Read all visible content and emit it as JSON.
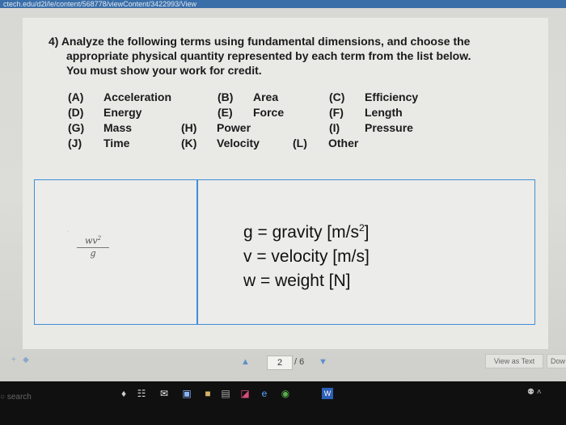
{
  "browser": {
    "url": "ctech.edu/d2l/le/content/568778/viewContent/3422993/View"
  },
  "question": {
    "lines": [
      "4) Analyze the following terms using fundamental dimensions, and choose the",
      "appropriate physical quantity represented by each term from the list below.",
      "You must show your work for credit."
    ],
    "options": [
      {
        "code": "(A)",
        "label": "Acceleration"
      },
      {
        "code": "(B)",
        "label": "Area"
      },
      {
        "code": "(C)",
        "label": "Efficiency"
      },
      {
        "code": "(D)",
        "label": "Energy"
      },
      {
        "code": "(E)",
        "label": "Force"
      },
      {
        "code": "(F)",
        "label": "Length"
      },
      {
        "code": "(G)",
        "label": "Mass"
      },
      {
        "code": "(H)",
        "label": "Power"
      },
      {
        "code": "(I)",
        "label": "Pressure"
      },
      {
        "code": "(J)",
        "label": "Time"
      },
      {
        "code": "(K)",
        "label": "Velocity"
      },
      {
        "code": "(L)",
        "label": "Other"
      }
    ]
  },
  "answer_table": {
    "term_numerator": "wv",
    "term_exponent": "2",
    "term_denominator": "g",
    "definitions": [
      {
        "lhs": "g = gravity [m/s",
        "sup": "2",
        "rhs": "]"
      },
      {
        "lhs": "v = velocity [m/s]",
        "sup": "",
        "rhs": ""
      },
      {
        "lhs": "w = weight [N]",
        "sup": "",
        "rhs": ""
      }
    ]
  },
  "viewer": {
    "current_page": "2",
    "total_pages": "/ 6",
    "view_as_text": "View as Text",
    "download": "Dow"
  },
  "taskbar": {
    "search": "search"
  }
}
